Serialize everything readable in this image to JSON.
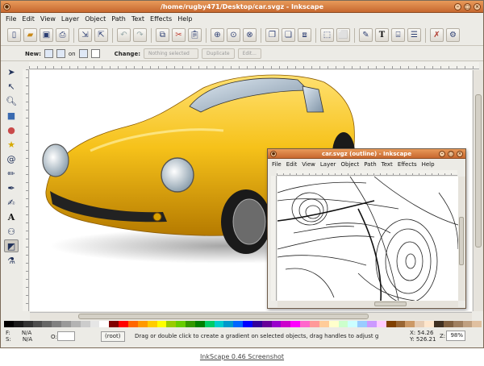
{
  "main_window": {
    "title": "/home/rugby471/Desktop/car.svgz - Inkscape",
    "menus": [
      "File",
      "Edit",
      "View",
      "Layer",
      "Object",
      "Path",
      "Text",
      "Effects",
      "Help"
    ],
    "toolbar_icons": [
      "new-doc-icon",
      "open-icon",
      "save-icon",
      "print-icon",
      "import-icon",
      "export-icon",
      "undo-icon",
      "redo-icon",
      "copy-icon",
      "cut-icon",
      "paste-icon",
      "zoom-selection-icon",
      "zoom-drawing-icon",
      "zoom-page-icon",
      "duplicate-icon",
      "clone-icon",
      "unlink-clone-icon",
      "group-icon",
      "ungroup-icon",
      "fill-stroke-icon",
      "text-font-icon",
      "xml-editor-icon",
      "align-icon",
      "preferences-icon",
      "document-props-icon"
    ]
  },
  "control_bar": {
    "new_label": "New:",
    "on_label": "on",
    "change_label": "Change:",
    "nothing_selected": "Nothing selected",
    "duplicate_label": "Duplicate",
    "edit_label": "Edit..."
  },
  "toolbox": [
    "selector-arrow-icon",
    "node-editor-icon",
    "zoom-icon",
    "rectangle-icon",
    "ellipse-icon",
    "star-icon",
    "spiral-icon",
    "pencil-icon",
    "pen-icon",
    "calligraphy-icon",
    "text-icon",
    "spray-connector-icon",
    "gradient-icon",
    "dropper-icon"
  ],
  "status": {
    "fill_label": "F:",
    "fill_value": "N/A",
    "stroke_label": "S:",
    "stroke_value": "N/A",
    "opacity_label": "O:",
    "layer": "(root)",
    "message": "Drag or double click to create a gradient on selected objects, drag handles to adjust g",
    "x": "X: 54.26",
    "y": "Y: 526.21",
    "zoom_label": "Z:",
    "zoom": "98%"
  },
  "sub_window": {
    "title": "car.svgz (outline) - Inkscape",
    "menus": [
      "File",
      "Edit",
      "View",
      "Layer",
      "Object",
      "Path",
      "Text",
      "Effects",
      "Help"
    ]
  },
  "caption": "InkScape 0.46 Screenshot",
  "palette_colors": [
    "#000000",
    "#1a1a1a",
    "#333333",
    "#4d4d4d",
    "#666666",
    "#808080",
    "#999999",
    "#b3b3b3",
    "#cccccc",
    "#e6e6e6",
    "#ffffff",
    "#800000",
    "#ff0000",
    "#ff6600",
    "#ff9900",
    "#ffcc00",
    "#ffff00",
    "#99cc00",
    "#66cc00",
    "#339900",
    "#008000",
    "#00cc66",
    "#00cccc",
    "#0099cc",
    "#0066ff",
    "#0000ff",
    "#330099",
    "#660099",
    "#9900cc",
    "#cc00cc",
    "#ff00ff",
    "#ff66cc",
    "#ff9999",
    "#ffcc99",
    "#ffffcc",
    "#ccffcc",
    "#ccffff",
    "#99ccff",
    "#cc99ff",
    "#ffccff",
    "#804000",
    "#996633",
    "#cc9966",
    "#e6ccb3",
    "#ffe6cc",
    "#403020",
    "#806040",
    "#a08060",
    "#c0a080",
    "#e0c0a0"
  ]
}
